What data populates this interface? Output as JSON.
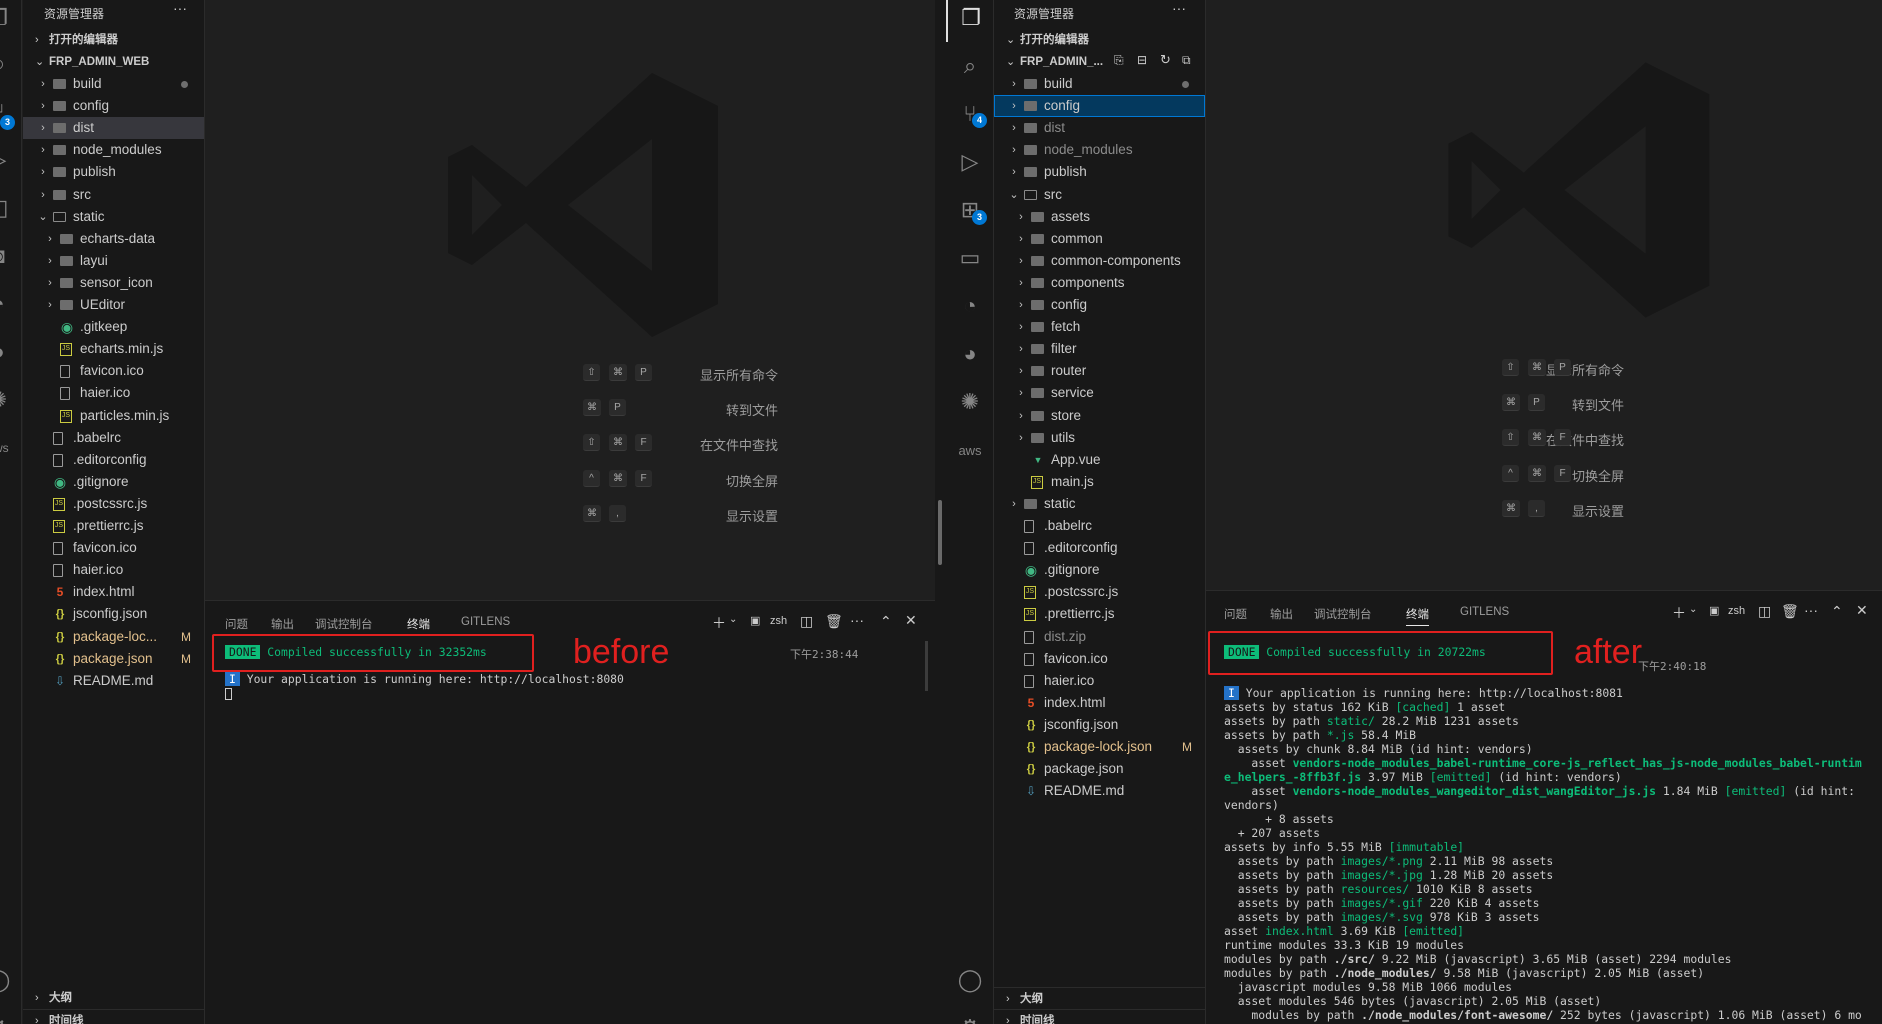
{
  "left": {
    "explorer_title": "资源管理器",
    "more": "···",
    "open_editors": "打开的编辑器",
    "project": "FRP_ADMIN_WEB",
    "tree": [
      {
        "label": "build",
        "type": "folder",
        "depth": 1,
        "dot": true
      },
      {
        "label": "config",
        "type": "folder",
        "depth": 1
      },
      {
        "label": "dist",
        "type": "folder",
        "depth": 1,
        "sel": true
      },
      {
        "label": "node_modules",
        "type": "folder",
        "depth": 1
      },
      {
        "label": "publish",
        "type": "folder",
        "depth": 1
      },
      {
        "label": "src",
        "type": "folder",
        "depth": 1
      },
      {
        "label": "static",
        "type": "folder-open",
        "depth": 1
      },
      {
        "label": "echarts-data",
        "type": "folder",
        "depth": 2
      },
      {
        "label": "layui",
        "type": "folder",
        "depth": 2
      },
      {
        "label": "sensor_icon",
        "type": "folder",
        "depth": 2
      },
      {
        "label": "UEditor",
        "type": "folder",
        "depth": 2
      },
      {
        "label": ".gitkeep",
        "type": "git",
        "depth": 2
      },
      {
        "label": "echarts.min.js",
        "type": "js",
        "depth": 2
      },
      {
        "label": "favicon.ico",
        "type": "file",
        "depth": 2
      },
      {
        "label": "haier.ico",
        "type": "file",
        "depth": 2
      },
      {
        "label": "particles.min.js",
        "type": "js",
        "depth": 2
      },
      {
        "label": ".babelrc",
        "type": "file",
        "depth": 1
      },
      {
        "label": ".editorconfig",
        "type": "file",
        "depth": 1
      },
      {
        "label": ".gitignore",
        "type": "git",
        "depth": 1
      },
      {
        "label": ".postcssrc.js",
        "type": "js",
        "depth": 1
      },
      {
        "label": ".prettierrc.js",
        "type": "js",
        "depth": 1
      },
      {
        "label": "favicon.ico",
        "type": "file",
        "depth": 1
      },
      {
        "label": "haier.ico",
        "type": "file",
        "depth": 1
      },
      {
        "label": "index.html",
        "type": "html",
        "depth": 1
      },
      {
        "label": "jsconfig.json",
        "type": "json",
        "depth": 1
      },
      {
        "label": "package-loc...",
        "type": "json",
        "depth": 1,
        "mod": "M",
        "gold": true
      },
      {
        "label": "package.json",
        "type": "json",
        "depth": 1,
        "mod": "M",
        "gold": true
      },
      {
        "label": "README.md",
        "type": "md",
        "depth": 1
      }
    ],
    "outline": "大纲",
    "timeline": "时间线",
    "commands": [
      {
        "label": "显示所有命令",
        "keys": [
          "⇧",
          "⌘",
          "P"
        ]
      },
      {
        "label": "转到文件",
        "keys": [
          "⌘",
          "P"
        ]
      },
      {
        "label": "在文件中查找",
        "keys": [
          "⇧",
          "⌘",
          "F"
        ]
      },
      {
        "label": "切换全屏",
        "keys": [
          "^",
          "⌘",
          "F"
        ]
      },
      {
        "label": "显示设置",
        "keys": [
          "⌘",
          ","
        ]
      }
    ],
    "panel_tabs": [
      "问题",
      "输出",
      "调试控制台",
      "终端",
      "GITLENS"
    ],
    "active_tab": "终端",
    "shell": "zsh",
    "done_badge": "DONE",
    "compiled": "Compiled successfully in 32352ms",
    "timestamp": "下午2:38:44",
    "running_badge": "I",
    "running": "Your application is running here: http://localhost:8080",
    "annotation": "before"
  },
  "right": {
    "explorer_title": "资源管理器",
    "more": "···",
    "open_editors": "打开的编辑器",
    "project": "FRP_ADMIN_...",
    "tree": [
      {
        "label": "build",
        "type": "folder",
        "depth": 1,
        "dot": true
      },
      {
        "label": "config",
        "type": "folder",
        "depth": 1,
        "focus": true
      },
      {
        "label": "dist",
        "type": "folder",
        "depth": 1,
        "dim": true
      },
      {
        "label": "node_modules",
        "type": "folder",
        "depth": 1,
        "dim": true
      },
      {
        "label": "publish",
        "type": "folder",
        "depth": 1
      },
      {
        "label": "src",
        "type": "folder-open",
        "depth": 1
      },
      {
        "label": "assets",
        "type": "folder",
        "depth": 2
      },
      {
        "label": "common",
        "type": "folder",
        "depth": 2
      },
      {
        "label": "common-components",
        "type": "folder",
        "depth": 2
      },
      {
        "label": "components",
        "type": "folder",
        "depth": 2
      },
      {
        "label": "config",
        "type": "folder",
        "depth": 2
      },
      {
        "label": "fetch",
        "type": "folder",
        "depth": 2
      },
      {
        "label": "filter",
        "type": "folder",
        "depth": 2
      },
      {
        "label": "router",
        "type": "folder",
        "depth": 2
      },
      {
        "label": "service",
        "type": "folder",
        "depth": 2
      },
      {
        "label": "store",
        "type": "folder",
        "depth": 2
      },
      {
        "label": "utils",
        "type": "folder",
        "depth": 2
      },
      {
        "label": "App.vue",
        "type": "vue",
        "depth": 2
      },
      {
        "label": "main.js",
        "type": "js",
        "depth": 2
      },
      {
        "label": "static",
        "type": "folder",
        "depth": 1
      },
      {
        "label": ".babelrc",
        "type": "file",
        "depth": 1
      },
      {
        "label": ".editorconfig",
        "type": "file",
        "depth": 1
      },
      {
        "label": ".gitignore",
        "type": "git",
        "depth": 1
      },
      {
        "label": ".postcssrc.js",
        "type": "js",
        "depth": 1
      },
      {
        "label": ".prettierrc.js",
        "type": "js",
        "depth": 1
      },
      {
        "label": "dist.zip",
        "type": "zip",
        "depth": 1,
        "dim": true
      },
      {
        "label": "favicon.ico",
        "type": "file",
        "depth": 1
      },
      {
        "label": "haier.ico",
        "type": "file",
        "depth": 1
      },
      {
        "label": "index.html",
        "type": "html",
        "depth": 1
      },
      {
        "label": "jsconfig.json",
        "type": "json",
        "depth": 1
      },
      {
        "label": "package-lock.json",
        "type": "json",
        "depth": 1,
        "mod": "M",
        "gold": true
      },
      {
        "label": "package.json",
        "type": "json",
        "depth": 1
      },
      {
        "label": "README.md",
        "type": "md",
        "depth": 1
      }
    ],
    "outline": "大纲",
    "timeline": "时间线",
    "commands": [
      {
        "label": "显示所有命令",
        "keys": [
          "⇧",
          "⌘",
          "P"
        ]
      },
      {
        "label": "转到文件",
        "keys": [
          "⌘",
          "P"
        ]
      },
      {
        "label": "在文件中查找",
        "keys": [
          "⇧",
          "⌘",
          "F"
        ]
      },
      {
        "label": "切换全屏",
        "keys": [
          "^",
          "⌘",
          "F"
        ]
      },
      {
        "label": "显示设置",
        "keys": [
          "⌘",
          ","
        ]
      }
    ],
    "panel_tabs": [
      "问题",
      "输出",
      "调试控制台",
      "终端",
      "GITLENS"
    ],
    "active_tab": "终端",
    "shell": "zsh",
    "done_badge": "DONE",
    "compiled": "Compiled successfully in 20722ms",
    "timestamp": "下午2:40:18",
    "running_badge": "I",
    "running": "Your application is running here: http://localhost:8081",
    "annotation": "after",
    "log": [
      [
        [
          "assets by status 162 KiB ",
          ""
        ],
        [
          "[cached]",
          "g"
        ],
        [
          " 1 asset",
          ""
        ]
      ],
      [
        [
          "assets by path ",
          ""
        ],
        [
          "static/",
          "g"
        ],
        [
          " 28.2 MiB 1231 assets",
          ""
        ]
      ],
      [
        [
          "assets by path ",
          ""
        ],
        [
          "*.js",
          "g"
        ],
        [
          " 58.4 MiB",
          ""
        ]
      ],
      [
        [
          "  assets by chunk 8.84 MiB (id hint: vendors)",
          ""
        ]
      ],
      [
        [
          "    asset ",
          ""
        ],
        [
          "vendors-node_modules_babel-runtime_core-js_reflect_has_js-node_modules_babel-runtim",
          "gb"
        ]
      ],
      [
        [
          "e_helpers_-8ffb3f.js",
          "gb"
        ],
        [
          " 3.97 MiB ",
          ""
        ],
        [
          "[emitted]",
          "g"
        ],
        [
          " (id hint: vendors)",
          ""
        ]
      ],
      [
        [
          "    asset ",
          ""
        ],
        [
          "vendors-node_modules_wangeditor_dist_wangEditor_js.js",
          "gb"
        ],
        [
          " 1.84 MiB ",
          ""
        ],
        [
          "[emitted]",
          "g"
        ],
        [
          " (id hint:",
          ""
        ]
      ],
      [
        [
          "vendors)",
          ""
        ]
      ],
      [
        [
          "      + 8 assets",
          ""
        ]
      ],
      [
        [
          "  + 207 assets",
          ""
        ]
      ],
      [
        [
          "assets by info 5.55 MiB ",
          ""
        ],
        [
          "[immutable]",
          "g"
        ]
      ],
      [
        [
          "  assets by path ",
          ""
        ],
        [
          "images/*.png",
          "g"
        ],
        [
          " 2.11 MiB 98 assets",
          ""
        ]
      ],
      [
        [
          "  assets by path ",
          ""
        ],
        [
          "images/*.jpg",
          "g"
        ],
        [
          " 1.28 MiB 20 assets",
          ""
        ]
      ],
      [
        [
          "  assets by path ",
          ""
        ],
        [
          "resources/",
          "g"
        ],
        [
          " 1010 KiB 8 assets",
          ""
        ]
      ],
      [
        [
          "  assets by path ",
          ""
        ],
        [
          "images/*.gif",
          "g"
        ],
        [
          " 220 KiB 4 assets",
          ""
        ]
      ],
      [
        [
          "  assets by path ",
          ""
        ],
        [
          "images/*.svg",
          "g"
        ],
        [
          " 978 KiB 3 assets",
          ""
        ]
      ],
      [
        [
          "asset ",
          ""
        ],
        [
          "index.html",
          "g"
        ],
        [
          " 3.69 KiB ",
          ""
        ],
        [
          "[emitted]",
          "g"
        ]
      ],
      [
        [
          "runtime modules 33.3 KiB 19 modules",
          ""
        ]
      ],
      [
        [
          "modules by path ",
          ""
        ],
        [
          "./src/",
          "b"
        ],
        [
          " 9.22 MiB (javascript) 3.65 MiB (asset) 2294 modules",
          ""
        ]
      ],
      [
        [
          "modules by path ",
          ""
        ],
        [
          "./node_modules/",
          "b"
        ],
        [
          " 9.58 MiB (javascript) 2.05 MiB (asset)",
          ""
        ]
      ],
      [
        [
          "  javascript modules 9.58 MiB 1066 modules",
          ""
        ]
      ],
      [
        [
          "  asset modules 546 bytes (javascript) 2.05 MiB (asset)",
          ""
        ]
      ],
      [
        [
          "    modules by path ",
          ""
        ],
        [
          "./node_modules/font-awesome/",
          "b"
        ],
        [
          " 252 bytes (javascript) 1.06 MiB (asset) 6 mo",
          ""
        ]
      ]
    ]
  },
  "icons": {
    "explorer": "files-icon",
    "search": "search-icon",
    "scm": "source-control-icon",
    "run": "run-debug-icon",
    "extensions": "extensions-icon",
    "remote": "remote-explorer-icon",
    "gitlens": "gitlens-icon",
    "timeline": "git-graph-icon",
    "copilot": "copilot-icon",
    "aws": "aws-icon",
    "account": "account-icon",
    "settings": "settings-icon"
  },
  "badges": {
    "left_scm": "3",
    "right_scm": "4",
    "right_ext": "3"
  },
  "aws_label": "aws"
}
